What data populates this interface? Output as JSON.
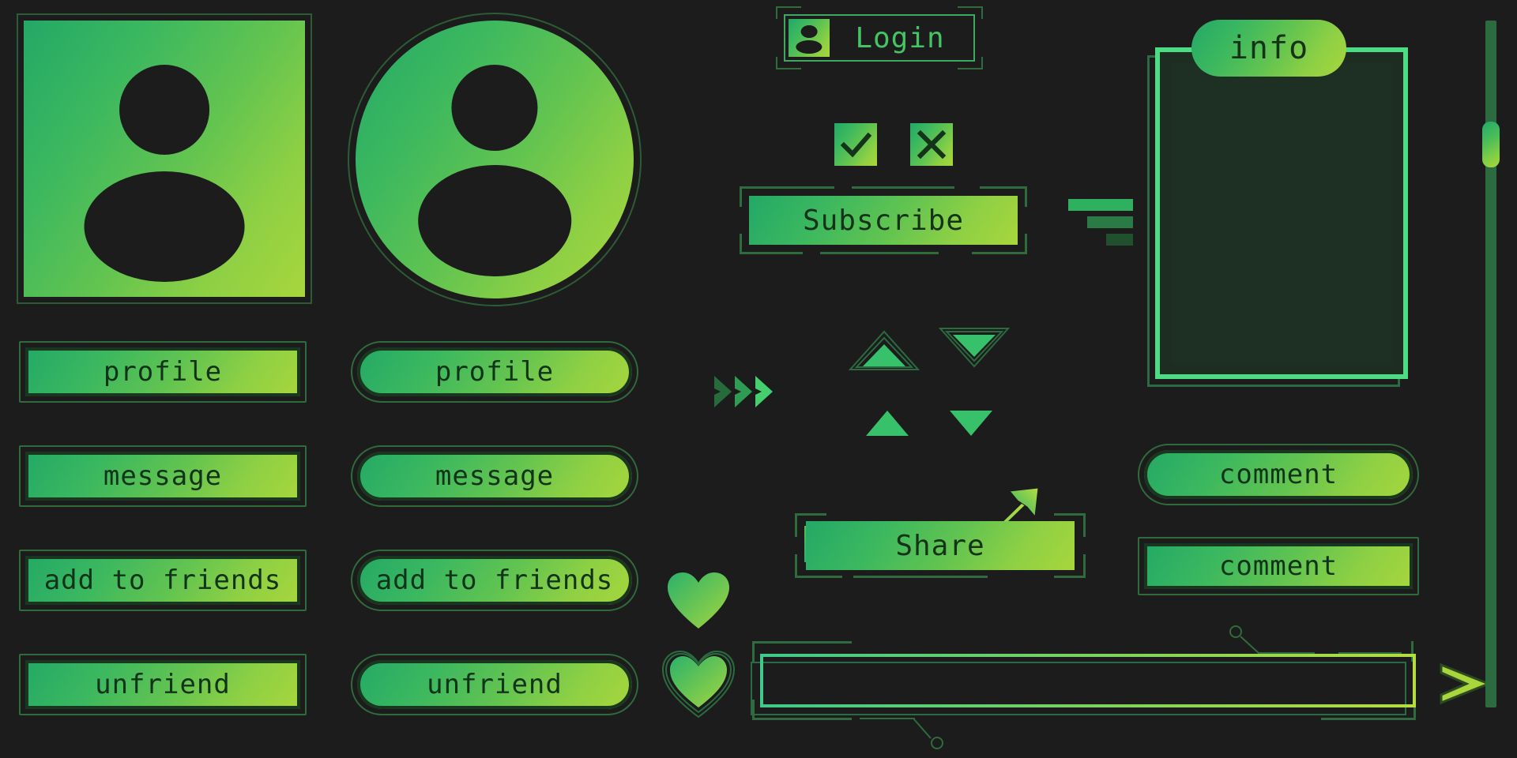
{
  "theme": {
    "background": "#1c1c1c",
    "gradient_start": "#23a866",
    "gradient_end": "#a8d63c",
    "text_dark": "#11331a",
    "accent_green": "#4ddc84",
    "outline_green": "#2f6b3c",
    "panel_fill": "#1e2f23"
  },
  "avatars": {
    "square": {
      "icon": "person-icon",
      "shape": "square"
    },
    "circle": {
      "icon": "person-icon",
      "shape": "circle"
    }
  },
  "buttons_rect": [
    {
      "label": "profile"
    },
    {
      "label": "message"
    },
    {
      "label": "add to friends"
    },
    {
      "label": "unfriend"
    }
  ],
  "buttons_pill": [
    {
      "label": "profile"
    },
    {
      "label": "message"
    },
    {
      "label": "add to friends"
    },
    {
      "label": "unfriend"
    }
  ],
  "login": {
    "label": "Login",
    "icon": "person-icon"
  },
  "toggles": [
    {
      "icon": "check-icon",
      "name": "accept"
    },
    {
      "icon": "close-icon",
      "name": "decline"
    }
  ],
  "subscribe": {
    "label": "Subscribe"
  },
  "bars": {
    "name": "signal-bars",
    "count": 3
  },
  "chevrons": {
    "name": "chevrons-right",
    "count": 3
  },
  "triangles": [
    {
      "name": "triangle-up-outlined",
      "direction": "up",
      "outlined": true
    },
    {
      "name": "triangle-down-outlined",
      "direction": "down",
      "outlined": true
    },
    {
      "name": "triangle-up",
      "direction": "up",
      "outlined": false
    },
    {
      "name": "triangle-down",
      "direction": "down",
      "outlined": false
    }
  ],
  "hearts": [
    {
      "name": "heart-icon",
      "outlined": false
    },
    {
      "name": "heart-icon-outlined",
      "outlined": true
    }
  ],
  "share": {
    "label": "Share",
    "icon": "arrow-up-right-icon"
  },
  "info_panel": {
    "label": "info"
  },
  "comments": [
    {
      "label": "comment",
      "shape": "pill"
    },
    {
      "label": "comment",
      "shape": "rect"
    }
  ],
  "input": {
    "value": "",
    "placeholder": "",
    "send_icon": "send-arrow-icon"
  },
  "scrollbar": {
    "name": "vertical-scrollbar",
    "thumb_position": "top"
  }
}
